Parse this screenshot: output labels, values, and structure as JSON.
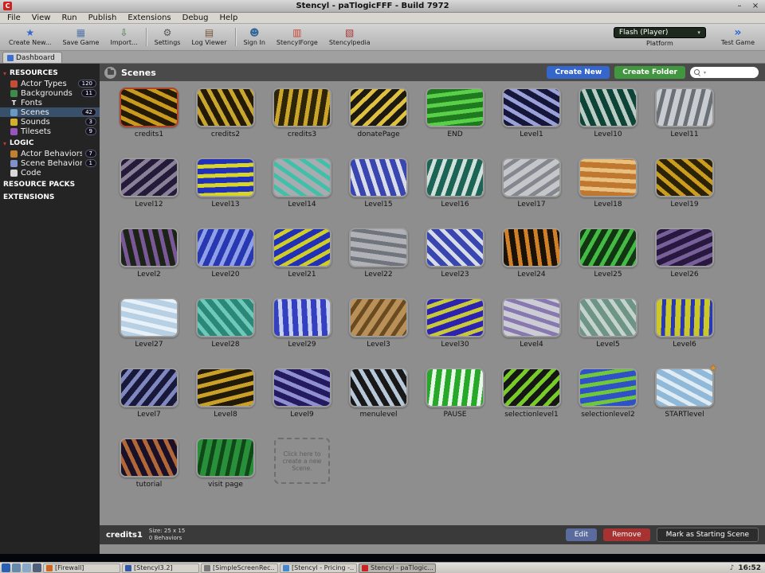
{
  "window": {
    "title": "Stencyl - paTlogicFFF - Build 7972",
    "icon_letter": "C",
    "minimize": "–",
    "close": "×"
  },
  "menubar": [
    "File",
    "View",
    "Run",
    "Publish",
    "Extensions",
    "Debug",
    "Help"
  ],
  "toolbar": {
    "items": [
      {
        "name": "create-new",
        "label": "Create New...",
        "glyph": "★",
        "color": "#3566cc"
      },
      {
        "name": "save-game",
        "label": "Save Game",
        "glyph": "▦",
        "color": "#5577aa"
      },
      {
        "name": "import",
        "label": "Import...",
        "glyph": "⇩",
        "color": "#447744"
      },
      {
        "sep": true
      },
      {
        "name": "settings",
        "label": "Settings",
        "glyph": "⚙",
        "color": "#555555"
      },
      {
        "name": "log-viewer",
        "label": "Log Viewer",
        "glyph": "▤",
        "color": "#775533"
      },
      {
        "sep": true
      },
      {
        "name": "sign-in",
        "label": "Sign In",
        "glyph": "☻",
        "color": "#336699"
      },
      {
        "name": "stencylforge",
        "label": "StencylForge",
        "glyph": "▥",
        "color": "#cc4433"
      },
      {
        "name": "stencylpedia",
        "label": "Stencylpedia",
        "glyph": "▧",
        "color": "#aa3333"
      }
    ],
    "platform_value": "Flash (Player)",
    "platform_label": "Platform",
    "platform_arrow": "▾",
    "test_game": "Test Game",
    "test_game_glyph": "»"
  },
  "tabs": [
    {
      "label": "Dashboard"
    }
  ],
  "sidebar": {
    "sections": [
      {
        "title": "RESOURCES",
        "bullet": true,
        "items": [
          {
            "label": "Actor Types",
            "badge": "120",
            "icon": "actor-types-icon",
            "icon_color": "#c44e33"
          },
          {
            "label": "Backgrounds",
            "badge": "11",
            "icon": "backgrounds-icon",
            "icon_color": "#3d8a4a"
          },
          {
            "label": "Fonts",
            "badge": "",
            "icon": "fonts-icon",
            "icon_color": "",
            "glyph": "T"
          },
          {
            "label": "Scenes",
            "badge": "42",
            "icon": "scenes-icon",
            "icon_color": "#6a9ac4",
            "selected": true
          },
          {
            "label": "Sounds",
            "badge": "3",
            "icon": "sounds-icon",
            "icon_color": "#d4b02a"
          },
          {
            "label": "Tilesets",
            "badge": "9",
            "icon": "tilesets-icon",
            "icon_color": "#9a55bb"
          }
        ]
      },
      {
        "title": "LOGIC",
        "bullet": true,
        "items": [
          {
            "label": "Actor Behaviors",
            "badge": "7",
            "icon": "actor-behaviors-icon",
            "icon_color": "#c08030"
          },
          {
            "label": "Scene Behaviors",
            "badge": "1",
            "icon": "scene-behaviors-icon",
            "icon_color": "#8090c8"
          },
          {
            "label": "Code",
            "badge": "",
            "icon": "code-icon",
            "icon_color": "#d8d8d8"
          }
        ]
      },
      {
        "title": "RESOURCE PACKS",
        "bullet": false,
        "items": []
      },
      {
        "title": "EXTENSIONS",
        "bullet": false,
        "items": []
      }
    ]
  },
  "main": {
    "header": {
      "title": "Scenes",
      "create_new": "Create New",
      "create_folder": "Create Folder",
      "search_placeholder": ""
    },
    "scenes": [
      {
        "name": "credits1",
        "c1": "#241a06",
        "c2": "#c99a1e",
        "selected": true
      },
      {
        "name": "credits2",
        "c1": "#241a06",
        "c2": "#c9a62e"
      },
      {
        "name": "credits3",
        "c1": "#2e2408",
        "c2": "#caa52a"
      },
      {
        "name": "donatePage",
        "c1": "#1c1a10",
        "c2": "#e0c040"
      },
      {
        "name": "END",
        "c1": "#1f7a1f",
        "c2": "#5ad04a"
      },
      {
        "name": "Level1",
        "c1": "#16163a",
        "c2": "#9aa0d8"
      },
      {
        "name": "Level10",
        "c1": "#0e4438",
        "c2": "#baccc4"
      },
      {
        "name": "Level11",
        "c1": "#c8ccd0",
        "c2": "#6a7076"
      },
      {
        "name": "Level12",
        "c1": "#241a3a",
        "c2": "#8a8098"
      },
      {
        "name": "Level13",
        "c1": "#2030b8",
        "c2": "#d8d428"
      },
      {
        "name": "Level14",
        "c1": "#a8acb0",
        "c2": "#40c0a8"
      },
      {
        "name": "Level15",
        "c1": "#3a46b0",
        "c2": "#d8dce8"
      },
      {
        "name": "Level16",
        "c1": "#1c6456",
        "c2": "#d0e0da"
      },
      {
        "name": "Level17",
        "c1": "#c4c6ca",
        "c2": "#84888e"
      },
      {
        "name": "Level18",
        "c1": "#c07830",
        "c2": "#e8c080"
      },
      {
        "name": "Level19",
        "c1": "#2c2206",
        "c2": "#cc9c1c"
      },
      {
        "name": "Level2",
        "c1": "#1c2418",
        "c2": "#7a5898"
      },
      {
        "name": "Level20",
        "c1": "#2838b0",
        "c2": "#90a0e8"
      },
      {
        "name": "Level21",
        "c1": "#2030b8",
        "c2": "#d0cc28"
      },
      {
        "name": "Level22",
        "c1": "#b0b2b8",
        "c2": "#70747c"
      },
      {
        "name": "Level23",
        "c1": "#3a46b0",
        "c2": "#d8dce8"
      },
      {
        "name": "Level24",
        "c1": "#1a1206",
        "c2": "#d08028"
      },
      {
        "name": "Level25",
        "c1": "#123612",
        "c2": "#44bb44"
      },
      {
        "name": "Level26",
        "c1": "#281840",
        "c2": "#786098"
      },
      {
        "name": "Level27",
        "c1": "#b8d0e4",
        "c2": "#e8f0f8"
      },
      {
        "name": "Level28",
        "c1": "#2a8878",
        "c2": "#70c8b8"
      },
      {
        "name": "Level29",
        "c1": "#3440c0",
        "c2": "#c8d0f0"
      },
      {
        "name": "Level3",
        "c1": "#b89058",
        "c2": "#6a4a20"
      },
      {
        "name": "Level30",
        "c1": "#2c24b0",
        "c2": "#c8c838"
      },
      {
        "name": "Level4",
        "c1": "#ccccd4",
        "c2": "#8878b0"
      },
      {
        "name": "Level5",
        "c1": "#6e9488",
        "c2": "#c4d4cc"
      },
      {
        "name": "Level6",
        "c1": "#ccc828",
        "c2": "#2838b8"
      },
      {
        "name": "Level7",
        "c1": "#181838",
        "c2": "#8088c0"
      },
      {
        "name": "Level8",
        "c1": "#221a08",
        "c2": "#caa028"
      },
      {
        "name": "Level9",
        "c1": "#241a60",
        "c2": "#9090d0"
      },
      {
        "name": "menulevel",
        "c1": "#181818",
        "c2": "#b8c8d8"
      },
      {
        "name": "PAUSE",
        "c1": "#28a828",
        "c2": "#e8f8e8"
      },
      {
        "name": "selectionlevel1",
        "c1": "#161616",
        "c2": "#78cc28"
      },
      {
        "name": "selectionlevel2",
        "c1": "#3050c8",
        "c2": "#70c838"
      },
      {
        "name": "STARTlevel",
        "c1": "#90b8d8",
        "c2": "#e0ecf4",
        "starred": true
      },
      {
        "name": "tutorial",
        "c1": "#1a1028",
        "c2": "#b06838"
      },
      {
        "name": "visit page",
        "c1": "#28903a",
        "c2": "#104818"
      }
    ],
    "placeholder": "Click here to create a new Scene."
  },
  "statusbar": {
    "selected_scene": "credits1",
    "size": "Size: 25 x 15",
    "behaviors": "0 Behaviors",
    "edit": "Edit",
    "remove": "Remove",
    "mark_starting": "Mark as Starting Scene"
  },
  "taskbar": {
    "launchers": [
      {
        "name": "app-menu",
        "color": "#2a5fb4"
      },
      {
        "name": "show-desktop",
        "color": "#6688aa"
      },
      {
        "name": "file-manager",
        "color": "#88a8c8"
      },
      {
        "name": "workspace-switcher",
        "color": "#50607a"
      }
    ],
    "windows": [
      {
        "label": "[Firewall]",
        "icon_color": "#cc6622"
      },
      {
        "label": "[Stencyl3.2]",
        "icon_color": "#3355aa"
      },
      {
        "label": "[SimpleScreenRec...",
        "icon_color": "#777777"
      },
      {
        "label": "[Stencyl - Pricing -...",
        "icon_color": "#4488cc"
      },
      {
        "label": "Stencyl - paTlogic...",
        "icon_color": "#cc2222",
        "active": true
      }
    ],
    "tray": {
      "volume_glyph": "♪",
      "time": "16:52"
    }
  }
}
